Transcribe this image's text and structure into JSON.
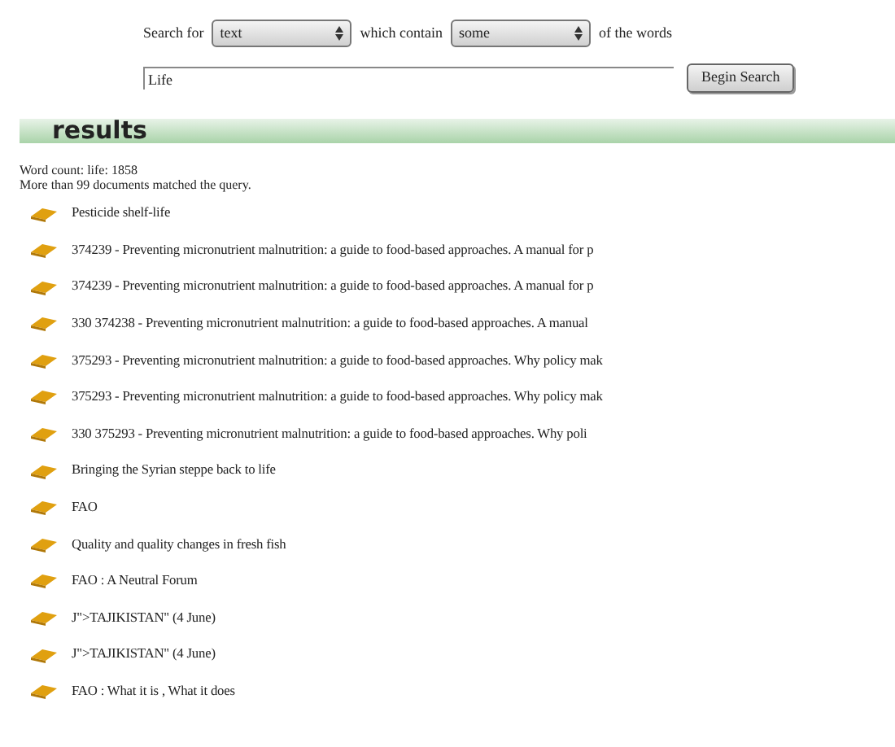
{
  "search_form": {
    "label_1": "Search for",
    "select_1": {
      "value": "text"
    },
    "label_2": "which contain",
    "select_2": {
      "value": "some"
    },
    "label_3": "of the words",
    "query": {
      "value": "Life"
    },
    "button": "Begin Search"
  },
  "results_header": {
    "title": "results"
  },
  "status": [
    "Word count: life: 1858",
    "More than 99 documents matched the query."
  ],
  "results": [
    {
      "title": "Pesticide shelf-life"
    },
    {
      "title": "374239 - Preventing micronutrient malnutrition: a guide to food-based approaches. A manual for p"
    },
    {
      "title": "374239 - Preventing micronutrient malnutrition: a guide to food-based approaches. A manual for p"
    },
    {
      "title": "330 374238 - Preventing micronutrient malnutrition: a guide to food-based approaches. A manual"
    },
    {
      "title": "375293 - Preventing micronutrient malnutrition: a guide to food-based approaches. Why policy mak"
    },
    {
      "title": "375293 - Preventing micronutrient malnutrition: a guide to food-based approaches. Why policy mak"
    },
    {
      "title": "330 375293 - Preventing micronutrient malnutrition: a guide to food-based approaches. Why poli"
    },
    {
      "title": "Bringing the Syrian steppe back to life"
    },
    {
      "title": "FAO"
    },
    {
      "title": "Quality and quality changes in fresh fish"
    },
    {
      "title": "FAO : A Neutral Forum"
    },
    {
      "title": "J\">TAJIKISTAN\" (4 June)"
    },
    {
      "title": "J\">TAJIKISTAN\" (4 June)"
    },
    {
      "title": "FAO : What it is , What it does"
    }
  ]
}
